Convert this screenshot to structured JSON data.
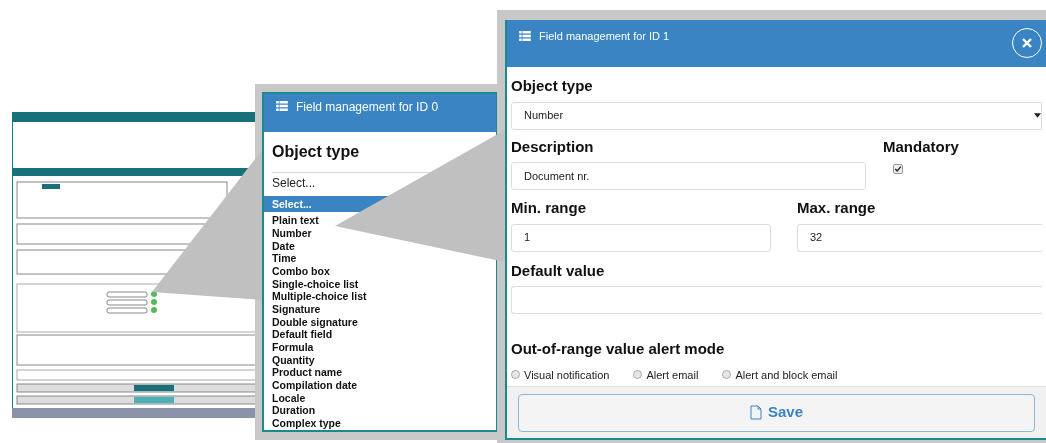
{
  "list_panel": {
    "title": "Field management for ID 0",
    "object_type_label": "Object type",
    "select_value": "Select...",
    "options": [
      {
        "label": "Select...",
        "selected": true
      },
      {
        "label": "Plain text",
        "selected": false
      },
      {
        "label": "Number",
        "selected": false
      },
      {
        "label": "Date",
        "selected": false
      },
      {
        "label": "Time",
        "selected": false
      },
      {
        "label": "Combo box",
        "selected": false
      },
      {
        "label": "Single-choice list",
        "selected": false
      },
      {
        "label": "Multiple-choice list",
        "selected": false
      },
      {
        "label": "Signature",
        "selected": false
      },
      {
        "label": "Double signature",
        "selected": false
      },
      {
        "label": "Default field",
        "selected": false
      },
      {
        "label": "Formula",
        "selected": false
      },
      {
        "label": "Quantity",
        "selected": false
      },
      {
        "label": "Product name",
        "selected": false
      },
      {
        "label": "Compilation date",
        "selected": false
      },
      {
        "label": "Locale",
        "selected": false
      },
      {
        "label": "Duration",
        "selected": false
      },
      {
        "label": "Complex type",
        "selected": false
      }
    ]
  },
  "dialog": {
    "title": "Field management for ID 1",
    "object_type": {
      "label": "Object type",
      "value": "Number"
    },
    "description": {
      "label": "Description",
      "value": "Document nr."
    },
    "mandatory": {
      "label": "Mandatory",
      "checked": true
    },
    "min_range": {
      "label": "Min. range",
      "value": "1"
    },
    "max_range": {
      "label": "Max. range",
      "value": "32"
    },
    "default_value": {
      "label": "Default value"
    },
    "alert_mode": {
      "label": "Out-of-range value alert mode",
      "options": [
        {
          "label": "Visual notification",
          "selected": false
        },
        {
          "label": "Alert email",
          "selected": false
        },
        {
          "label": "Alert and block email",
          "selected": false
        }
      ]
    },
    "save_button": "Save"
  }
}
